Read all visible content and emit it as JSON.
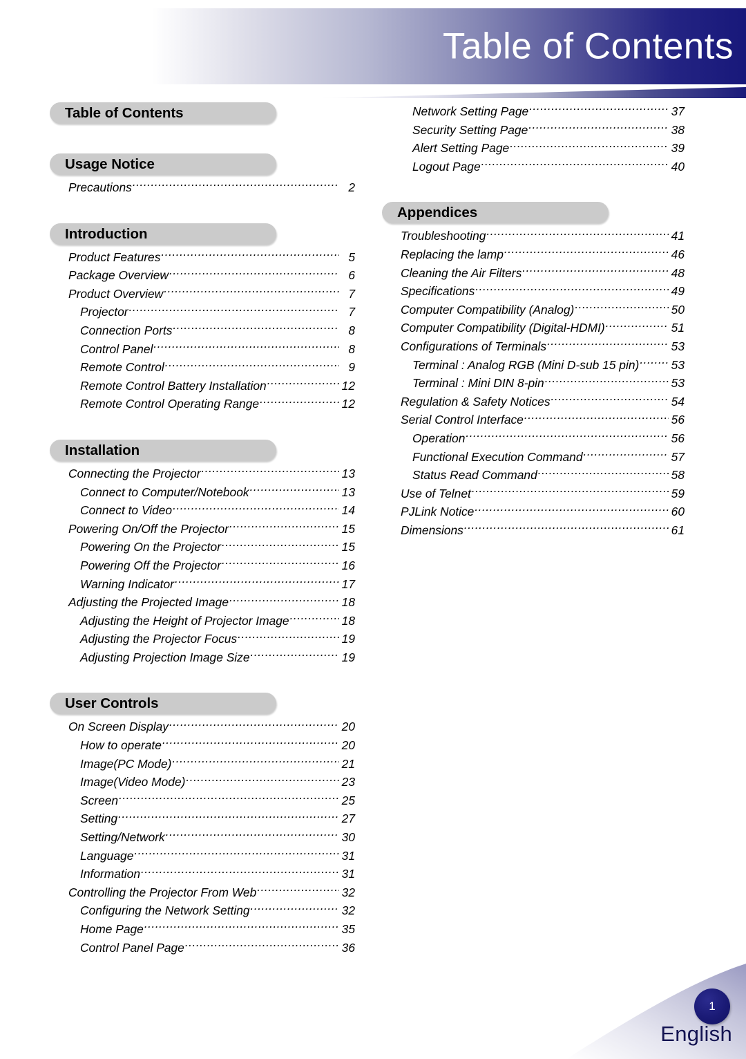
{
  "header": {
    "title": "Table of Contents",
    "band_start_color": "#ffffff",
    "band_end_color": "#18187a"
  },
  "footer": {
    "page_number": "1",
    "language": "English",
    "badge_color": "#1a1a75"
  },
  "theme": {
    "pill_background": "#cbcbcb",
    "text_color": "#000000",
    "accent_navy": "#18187a"
  },
  "left_column": [
    {
      "heading": "Table of Contents",
      "entries": []
    },
    {
      "heading": "Usage Notice",
      "entries": [
        {
          "title": "Precautions",
          "page": "2",
          "level": 1
        }
      ]
    },
    {
      "heading": "Introduction",
      "entries": [
        {
          "title": "Product Features",
          "page": "5",
          "level": 1
        },
        {
          "title": "Package Overview",
          "page": "6",
          "level": 1
        },
        {
          "title": "Product Overview",
          "page": "7",
          "level": 1
        },
        {
          "title": "Projector",
          "page": "7",
          "level": 2
        },
        {
          "title": "Connection Ports",
          "page": "8",
          "level": 2
        },
        {
          "title": "Control Panel",
          "page": "8",
          "level": 2
        },
        {
          "title": "Remote Control",
          "page": "9",
          "level": 2
        },
        {
          "title": "Remote Control Battery Installation",
          "page": "12",
          "level": 2
        },
        {
          "title": "Remote Control Operating Range",
          "page": "12",
          "level": 2
        }
      ]
    },
    {
      "heading": "Installation",
      "entries": [
        {
          "title": "Connecting the Projector",
          "page": "13",
          "level": 1
        },
        {
          "title": "Connect to Computer/Notebook",
          "page": "13",
          "level": 2
        },
        {
          "title": "Connect to Video",
          "page": "14",
          "level": 2
        },
        {
          "title": "Powering On/Off the Projector",
          "page": "15",
          "level": 1
        },
        {
          "title": "Powering On the Projector",
          "page": "15",
          "level": 2
        },
        {
          "title": "Powering Off the Projector",
          "page": "16",
          "level": 2
        },
        {
          "title": "Warning Indicator",
          "page": "17",
          "level": 2
        },
        {
          "title": "Adjusting the Projected Image",
          "page": "18",
          "level": 1
        },
        {
          "title": "Adjusting the Height of Projector Image",
          "page": "18",
          "level": 2
        },
        {
          "title": "Adjusting the Projector Focus",
          "page": "19",
          "level": 2
        },
        {
          "title": "Adjusting Projection Image Size",
          "page": "19",
          "level": 2
        }
      ]
    },
    {
      "heading": "User Controls",
      "entries": [
        {
          "title": "On Screen Display",
          "page": "20",
          "level": 1
        },
        {
          "title": "How to operate",
          "page": "20",
          "level": 2
        },
        {
          "title": "Image(PC Mode)",
          "page": "21",
          "level": 2
        },
        {
          "title": "Image(Video Mode)",
          "page": "23",
          "level": 2
        },
        {
          "title": "Screen",
          "page": "25",
          "level": 2
        },
        {
          "title": "Setting",
          "page": "27",
          "level": 2
        },
        {
          "title": "Setting/Network",
          "page": "30",
          "level": 2
        },
        {
          "title": "Language",
          "page": "31",
          "level": 2
        },
        {
          "title": "Information",
          "page": "31",
          "level": 2
        },
        {
          "title": "Controlling the Projector From Web",
          "page": "32",
          "level": 1
        },
        {
          "title": "Configuring the Network Setting",
          "page": "32",
          "level": 2
        },
        {
          "title": "Home Page",
          "page": "35",
          "level": 2
        },
        {
          "title": "Control Panel Page",
          "page": "36",
          "level": 2
        }
      ]
    }
  ],
  "right_column": [
    {
      "heading": null,
      "entries": [
        {
          "title": "Network Setting Page",
          "page": "37",
          "level": 2
        },
        {
          "title": "Security Setting Page",
          "page": "38",
          "level": 2
        },
        {
          "title": "Alert Setting Page",
          "page": "39",
          "level": 2
        },
        {
          "title": "Logout Page",
          "page": "40",
          "level": 2
        }
      ]
    },
    {
      "heading": "Appendices",
      "entries": [
        {
          "title": "Troubleshooting",
          "page": "41",
          "level": 1
        },
        {
          "title": "Replacing the lamp",
          "page": "46",
          "level": 1
        },
        {
          "title": "Cleaning the Air Filters",
          "page": "48",
          "level": 1
        },
        {
          "title": "Specifications",
          "page": "49",
          "level": 1
        },
        {
          "title": "Computer Compatibility (Analog)",
          "page": "50",
          "level": 1
        },
        {
          "title": "Computer Compatibility (Digital-HDMI)",
          "page": "51",
          "level": 1
        },
        {
          "title": "Configurations of Terminals",
          "page": "53",
          "level": 1
        },
        {
          "title": "Terminal : Analog RGB (Mini D-sub 15 pin)",
          "page": "53",
          "level": 2
        },
        {
          "title": "Terminal : Mini DIN 8-pin",
          "page": "53",
          "level": 2
        },
        {
          "title": "Regulation & Safety Notices",
          "page": "54",
          "level": 1
        },
        {
          "title": "Serial Control Interface",
          "page": "56",
          "level": 1
        },
        {
          "title": "Operation",
          "page": "56",
          "level": 2
        },
        {
          "title": "Functional Execution Command",
          "page": "57",
          "level": 2
        },
        {
          "title": "Status Read Command",
          "page": "58",
          "level": 2
        },
        {
          "title": "Use of Telnet",
          "page": "59",
          "level": 1
        },
        {
          "title": "PJLink Notice",
          "page": "60",
          "level": 1
        },
        {
          "title": "Dimensions",
          "page": "61",
          "level": 1
        }
      ]
    }
  ]
}
